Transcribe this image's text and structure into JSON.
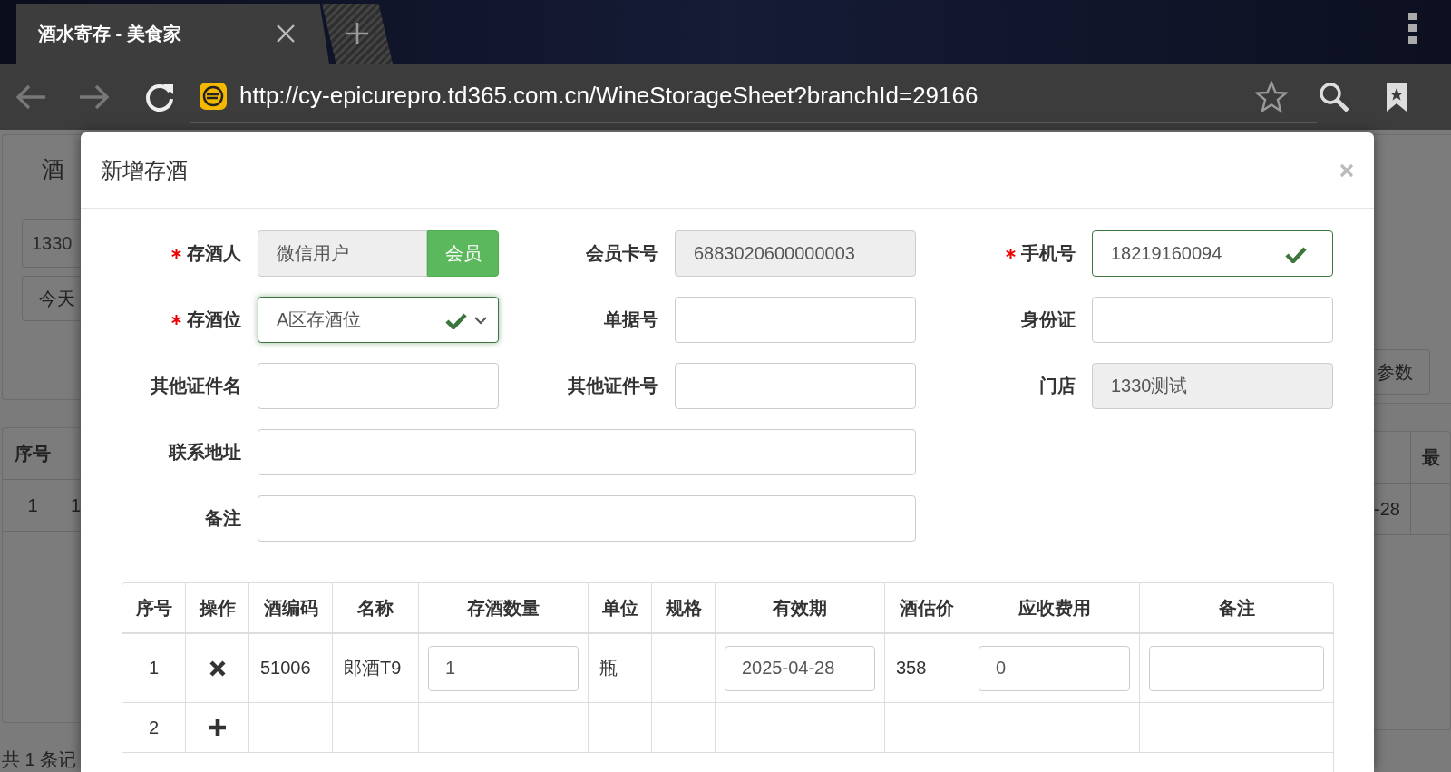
{
  "browser": {
    "tab_title": "酒水寄存 - 美食家",
    "url": "http://cy-epicurepro.td365.com.cn/WineStorageSheet?branchId=29166"
  },
  "background": {
    "title": "酒",
    "search_value": "1330",
    "today_button": "今天",
    "params_button": "参数",
    "table_left_header": "序号",
    "table_left_row": [
      "1",
      "1"
    ],
    "table_right_header": "最",
    "table_right_row": "-28",
    "footer": "共 1 条记"
  },
  "modal": {
    "title": "新增存酒",
    "fields": [
      {
        "label": "存酒人",
        "kind": "member",
        "required": true,
        "disabled": true,
        "valid": false,
        "value": "微信用户",
        "button": "会员"
      },
      {
        "label": "会员卡号",
        "kind": "text",
        "required": false,
        "disabled": true,
        "valid": false,
        "value": "6883020600000003"
      },
      {
        "label": "手机号",
        "kind": "text",
        "required": true,
        "disabled": false,
        "valid": true,
        "value": "18219160094"
      },
      {
        "label": "存酒位",
        "kind": "select",
        "required": true,
        "disabled": false,
        "valid": true,
        "value": "A区存酒位"
      },
      {
        "label": "单据号",
        "kind": "text",
        "required": false,
        "disabled": false,
        "valid": false
      },
      {
        "label": "身份证",
        "kind": "text",
        "required": false,
        "disabled": false,
        "valid": false
      },
      {
        "label": "其他证件名",
        "kind": "text",
        "required": false,
        "disabled": false,
        "valid": false
      },
      {
        "label": "其他证件号",
        "kind": "text",
        "required": false,
        "disabled": false,
        "valid": false
      },
      {
        "label": "门店",
        "kind": "text",
        "required": false,
        "disabled": true,
        "valid": false,
        "value": "1330测试"
      },
      {
        "label": "联系地址",
        "kind": "wide",
        "required": false,
        "disabled": false,
        "valid": false
      },
      {
        "label": "备注",
        "kind": "wide",
        "required": false,
        "disabled": false,
        "valid": false
      }
    ],
    "table": {
      "columns": [
        "序号",
        "操作",
        "酒编码",
        "名称",
        "存酒数量",
        "单位",
        "规格",
        "有效期",
        "酒估价",
        "应收费用",
        "备注"
      ],
      "rows": [
        {
          "kind": "item",
          "cells": [
            {
              "kind": "text",
              "text": "1"
            },
            {
              "kind": "remove"
            },
            {
              "kind": "text",
              "text": "51006"
            },
            {
              "kind": "text",
              "text": "郎酒T9"
            },
            {
              "kind": "input",
              "value": "1"
            },
            {
              "kind": "text",
              "text": "瓶"
            },
            {
              "kind": "empty"
            },
            {
              "kind": "input",
              "value": "2025-04-28"
            },
            {
              "kind": "text",
              "text": "358"
            },
            {
              "kind": "input",
              "value": "0"
            },
            {
              "kind": "input"
            }
          ]
        },
        {
          "kind": "add",
          "cells": [
            {
              "kind": "text",
              "text": "2"
            },
            {
              "kind": "add"
            }
          ]
        }
      ]
    }
  }
}
